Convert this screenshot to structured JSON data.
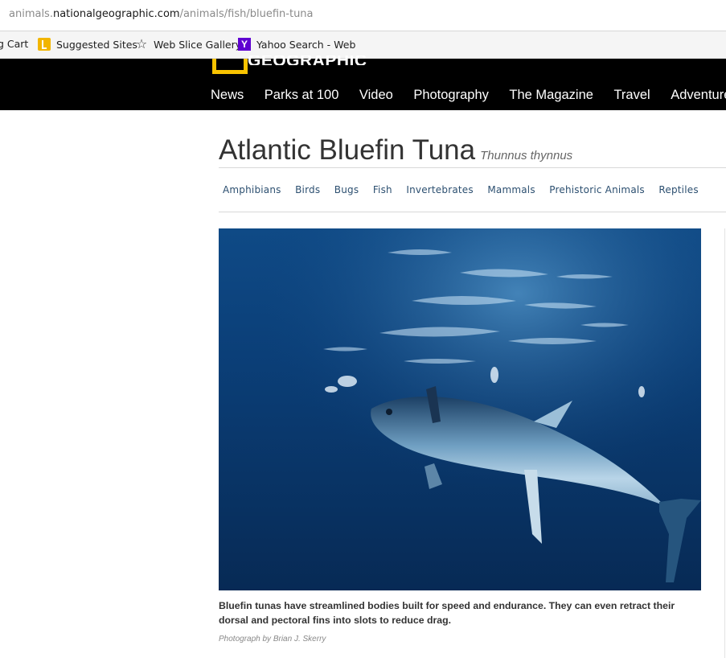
{
  "browser": {
    "url_prefix": "animals.",
    "url_domain": "nationalgeographic.com",
    "url_path": "/animals/fish/bluefin-tuna"
  },
  "favorites": [
    {
      "label": "g Cart",
      "icon": "none"
    },
    {
      "label": "Suggested Sites",
      "icon": "bing-icon"
    },
    {
      "label": "Web Slice Gallery",
      "icon": "star-icon"
    },
    {
      "label": "Yahoo Search - Web",
      "icon": "yahoo-icon"
    }
  ],
  "site": {
    "logo_text": "GEOGRAPHIC",
    "brand_color": "#f8c300",
    "nav": [
      "News",
      "Parks at 100",
      "Video",
      "Photography",
      "The Magazine",
      "Travel",
      "Adventure"
    ]
  },
  "page": {
    "title": "Atlantic Bluefin Tuna",
    "scientific_name": "Thunnus thynnus",
    "categories": [
      "Amphibians",
      "Birds",
      "Bugs",
      "Fish",
      "Invertebrates",
      "Mammals",
      "Prehistoric Animals",
      "Reptiles"
    ],
    "caption": "Bluefin tunas have streamlined bodies built for speed and endurance. They can even retract their dorsal and pectoral fins into slots to reduce drag.",
    "credit": "Photograph by Brian J. Skerry"
  }
}
